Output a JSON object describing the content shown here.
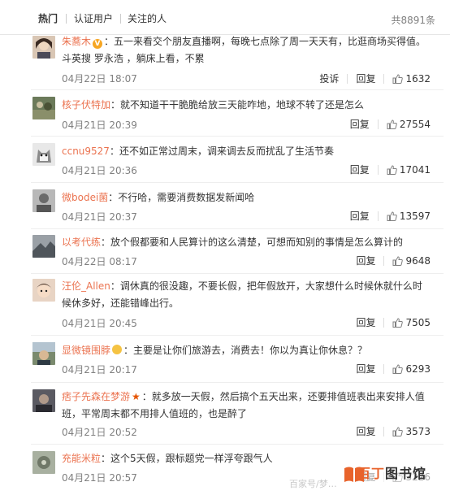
{
  "tabs": [
    {
      "label": "热门",
      "active": true
    },
    {
      "label": "认证用户",
      "active": false
    },
    {
      "label": "关注的人",
      "active": false
    }
  ],
  "total_count": "共8891条",
  "actions": {
    "report": "投诉",
    "reply": "回复"
  },
  "colors": {
    "username": "#eb7350",
    "badge_gold": "#f6a623",
    "star": "#e55400"
  },
  "comments": [
    {
      "user": "朱蕎木",
      "badge": "v-gold-icon",
      "line1": "：五一来看交个朋友直播啊，每晚七点除了周一天天有，比逛商场买得值。",
      "line2": "斗英搜 罗永浩 ，躺床上看，不累",
      "time": "04月22日 18:07",
      "likes": "1632",
      "has_report": true
    },
    {
      "user": "核子伏特加",
      "line1": "：就不知道干干脆脆给放三天能咋地，地球不转了还是怎么",
      "time": "04月21日 20:39",
      "likes": "27554"
    },
    {
      "user": "ccnu9527",
      "line1": "：还不如正常过周末，调来调去反而扰乱了生活节奏",
      "time": "04月21日 20:36",
      "likes": "17041"
    },
    {
      "user": "微bodei菌",
      "line1": "：不行哈，需要消费数据发新闻哈",
      "time": "04月21日 20:37",
      "likes": "13597"
    },
    {
      "user": "以考代练",
      "line1": "：放个假都要和人民算计的这么清楚，可想而知别的事情是怎么算计的",
      "time": "04月22日 08:17",
      "likes": "9648"
    },
    {
      "user": "汪伦_Allen",
      "line1": "：调休真的很没趣，不要长假，把年假放开，大家想什么时候休就什么时",
      "line2": "候休多好，还能错峰出行。",
      "time": "04月21日 20:45",
      "likes": "7505"
    },
    {
      "user": "显微镜围脖",
      "badge": "emoji-face-icon",
      "line1": "：主要是让你们旅游去，消费去！你以为真让你休息？？",
      "time": "04月21日 20:17",
      "likes": "6293"
    },
    {
      "user": "痞子先森在梦游",
      "badge": "star-icon",
      "line1": "：就多放一天假，然后搞个五天出来，还要排值班表出来安排人值",
      "line2": "班，平常周末都不用排人值班的，也是醉了",
      "time": "04月21日 20:52",
      "likes": "3573"
    },
    {
      "user": "充能米粒",
      "line1": "：这个5天假，跟标题党一样浮夸跟气人",
      "time": "04月21日 20:57",
      "likes": "3226"
    }
  ],
  "watermark": {
    "brand_orange": "百丁",
    "brand_dark": "图书馆",
    "faded": "百家号/梦…"
  }
}
